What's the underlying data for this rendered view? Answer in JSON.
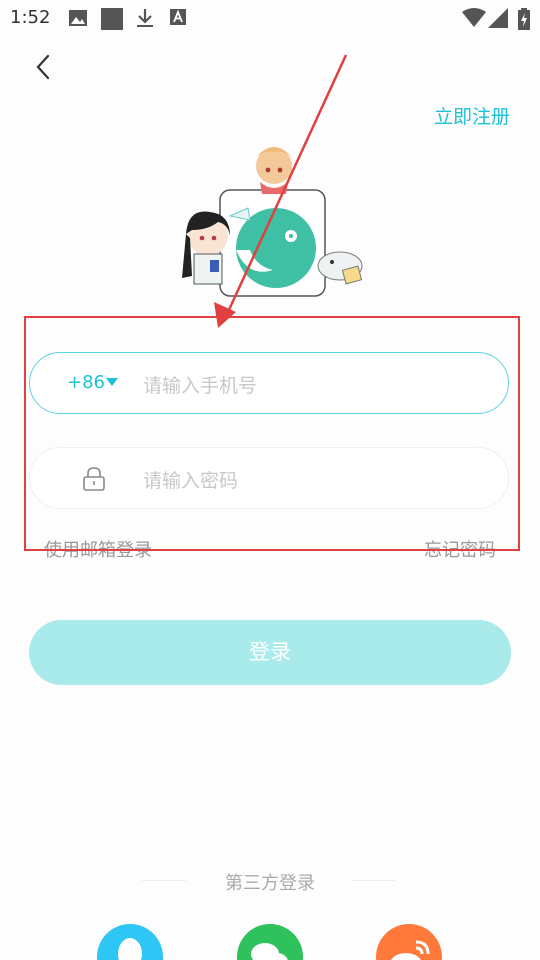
{
  "status_bar": {
    "time": "1:52"
  },
  "header": {
    "back_icon": "chevron-left-icon",
    "register_label": "立即注册"
  },
  "form": {
    "country_code": "+86",
    "phone_placeholder": "请输入手机号",
    "password_placeholder": "请输入密码",
    "email_login_label": "使用邮箱登录",
    "forgot_password_label": "忘记密码",
    "login_button_label": "登录"
  },
  "third_party": {
    "label": "第三方登录",
    "providers": [
      "qq-icon",
      "wechat-icon",
      "weibo-icon"
    ]
  },
  "colors": {
    "accent": "#1cc2d6",
    "login_button_bg": "#a8ebea",
    "annotation": "#e04040"
  }
}
